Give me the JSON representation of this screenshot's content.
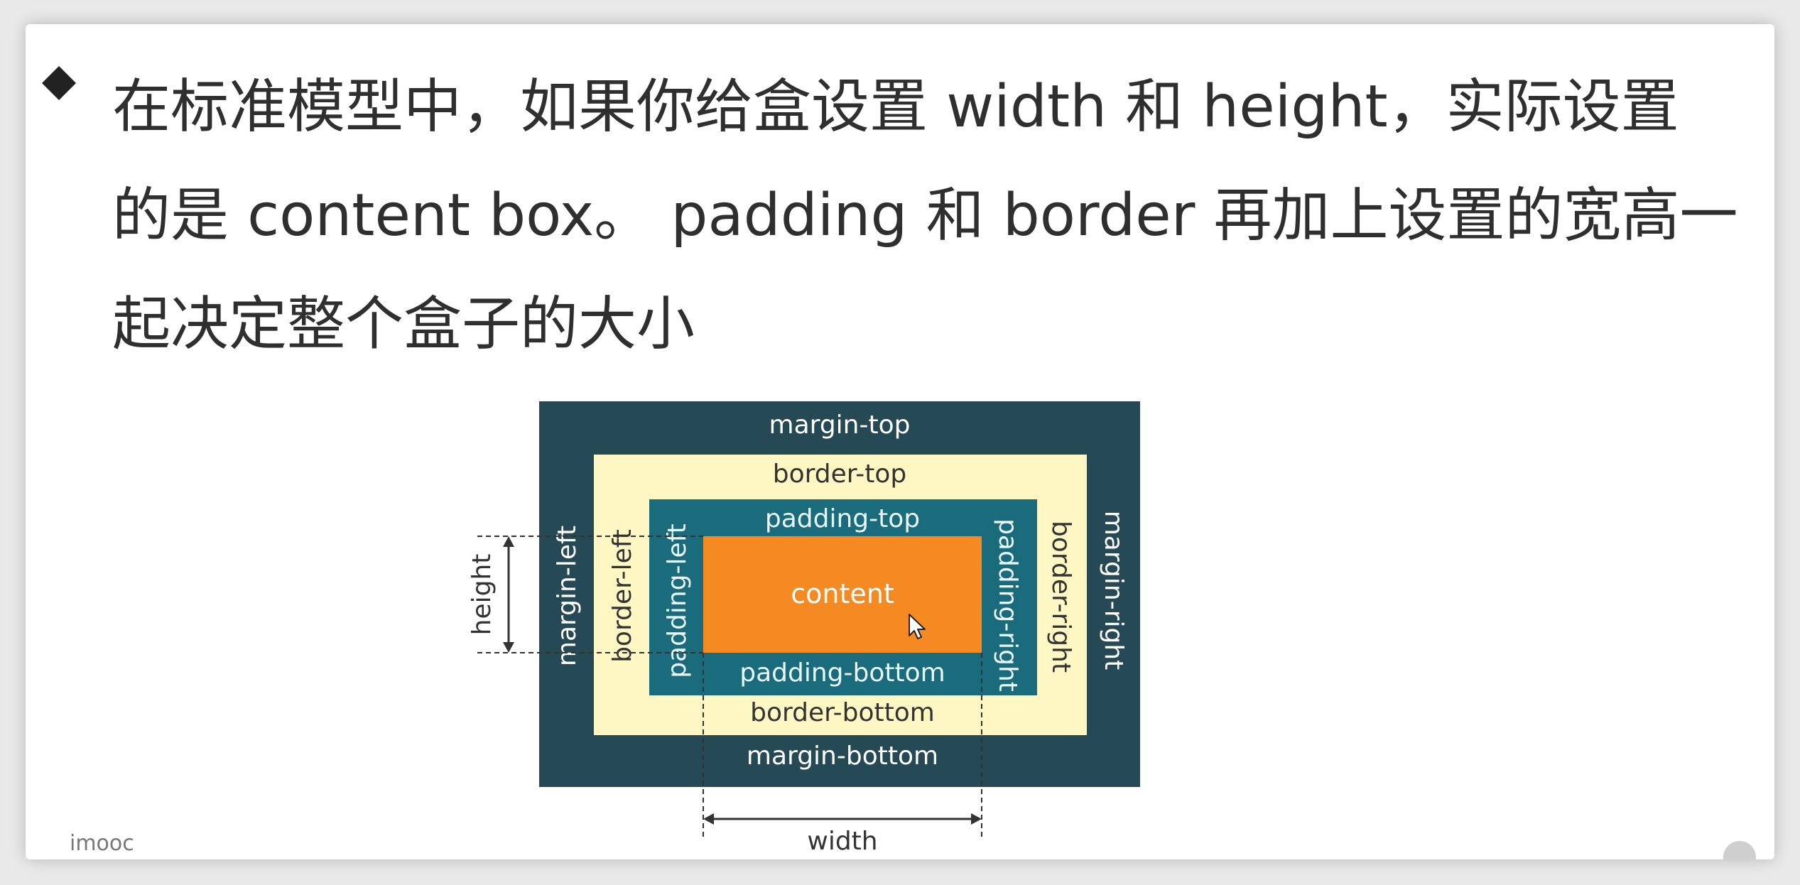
{
  "slide": {
    "bullet_icon": "diamond-bullet-icon",
    "text_lines": [
      "在标准模型中，如果你给盒设置 width 和 height，实际设置",
      "的是 content box。 padding 和 border 再加上设置的宽高一",
      "起决定整个盒子的大小"
    ],
    "watermark": "imooc"
  },
  "diagram": {
    "labels": {
      "margin_top": "margin-top",
      "margin_bottom": "margin-bottom",
      "margin_left": "margin-left",
      "margin_right": "margin-right",
      "border_top": "border-top",
      "border_bottom": "border-bottom",
      "border_left": "border-left",
      "border_right": "border-right",
      "padding_top": "padding-top",
      "padding_bottom": "padding-bottom",
      "padding_left": "padding-left",
      "padding_right": "padding-right",
      "content": "content",
      "height": "height",
      "width": "width"
    },
    "colors": {
      "margin": "#254a55",
      "border": "#fef7c3",
      "padding": "#1a6b7c",
      "content": "#f58a22",
      "margin_text": "#ffffff",
      "border_text": "#333333",
      "padding_text": "#e8f6fa",
      "content_text": "#ffffff",
      "dimension": "#333333"
    },
    "cursor_icon": "mouse-pointer-icon"
  }
}
